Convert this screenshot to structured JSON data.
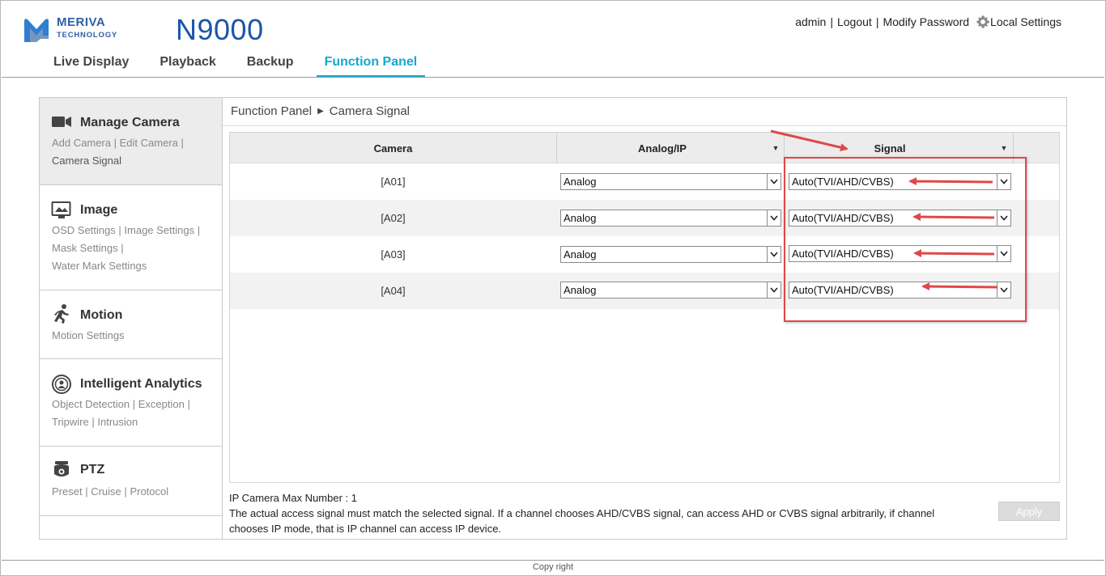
{
  "brand": {
    "name": "MERIVA",
    "sub": "TECHNOLOGY",
    "model": "N9000"
  },
  "topnav": {
    "user": "admin",
    "logout": "Logout",
    "modify_password": "Modify Password",
    "local_settings": "Local Settings",
    "separator": "|"
  },
  "tabs": [
    {
      "label": "Live Display"
    },
    {
      "label": "Playback"
    },
    {
      "label": "Backup"
    },
    {
      "label": "Function Panel"
    }
  ],
  "sidebar": {
    "manage_camera": {
      "title": "Manage Camera",
      "links": [
        "Add Camera",
        "Edit Camera",
        "Camera Signal"
      ]
    },
    "image": {
      "title": "Image",
      "links": [
        "OSD Settings",
        "Image Settings",
        "Mask Settings",
        "Water Mark Settings"
      ]
    },
    "motion": {
      "title": "Motion",
      "links": [
        "Motion Settings"
      ]
    },
    "analytics": {
      "title": "Intelligent Analytics",
      "links": [
        "Object Detection",
        "Exception",
        "Tripwire",
        "Intrusion"
      ]
    },
    "ptz": {
      "title": "PTZ",
      "links": [
        "Preset",
        "Cruise",
        "Protocol"
      ]
    },
    "sep": "|"
  },
  "breadcrumb": {
    "root": "Function Panel",
    "current": "Camera Signal"
  },
  "table": {
    "headers": {
      "camera": "Camera",
      "analog_ip": "Analog/IP",
      "signal": "Signal"
    },
    "rows": [
      {
        "camera": "[A01]",
        "analog_ip": "Analog",
        "signal": "Auto(TVI/AHD/CVBS)"
      },
      {
        "camera": "[A02]",
        "analog_ip": "Analog",
        "signal": "Auto(TVI/AHD/CVBS)"
      },
      {
        "camera": "[A03]",
        "analog_ip": "Analog",
        "signal": "Auto(TVI/AHD/CVBS)"
      },
      {
        "camera": "[A04]",
        "analog_ip": "Analog",
        "signal": "Auto(TVI/AHD/CVBS)"
      }
    ]
  },
  "notes": {
    "max_number": "IP Camera Max Number : 1",
    "description": "The actual access signal must match the selected signal. If a channel chooses AHD/CVBS signal, can access AHD or CVBS signal arbitrarily, if channel chooses IP mode, that is IP channel can access IP device."
  },
  "apply_label": "Apply",
  "footer": "Copy right",
  "colors": {
    "accent": "#16a7d0",
    "brand": "#1a56a8",
    "annotation": "#e04848"
  }
}
